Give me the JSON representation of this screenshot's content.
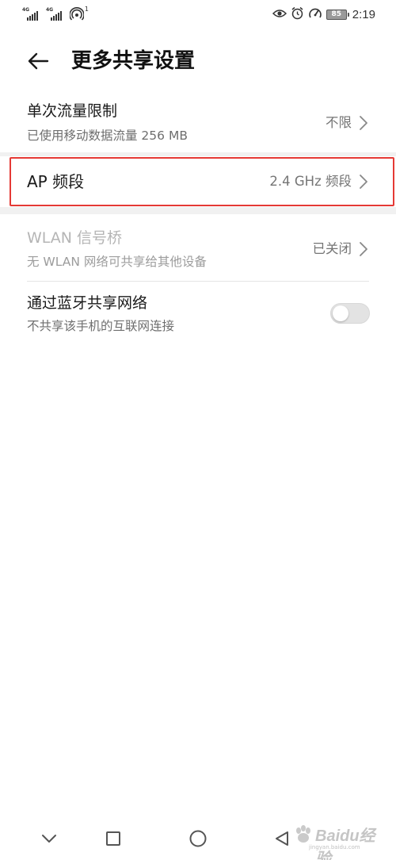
{
  "status_bar": {
    "signal_1_network": "4G",
    "signal_2_network": "4G",
    "hotspot_clients": "1",
    "battery_level": "85",
    "time": "2:19",
    "icons": [
      "eye-comfort-icon",
      "alarm-icon",
      "speed-gauge-icon",
      "battery-icon"
    ]
  },
  "header": {
    "back_icon": "arrow-left-icon",
    "title": "更多共享设置"
  },
  "settings": {
    "data_limit": {
      "title": "单次流量限制",
      "subtitle": "已使用移动数据流量 256 MB",
      "value": "不限"
    },
    "ap_band": {
      "title": "AP 频段",
      "value": "2.4 GHz 频段",
      "highlighted": true
    },
    "wlan_bridge": {
      "title": "WLAN 信号桥",
      "subtitle": "无 WLAN 网络可共享给其他设备",
      "value": "已关闭",
      "enabled": false
    },
    "bluetooth_tethering": {
      "title": "通过蓝牙共享网络",
      "subtitle": "不共享该手机的互联网连接",
      "toggle_on": false
    }
  },
  "nav_bar": {
    "buttons": [
      "chevron-down-icon",
      "recent-apps-icon",
      "home-icon",
      "back-triangle-icon"
    ]
  },
  "watermark": {
    "text": "Baidu经验",
    "url": "jingyan.baidu.com"
  },
  "colors": {
    "highlight_border": "#e53935",
    "section_gap": "#f1f1f1",
    "secondary_text": "#757575",
    "toggle_off": "#e3e3e3"
  }
}
